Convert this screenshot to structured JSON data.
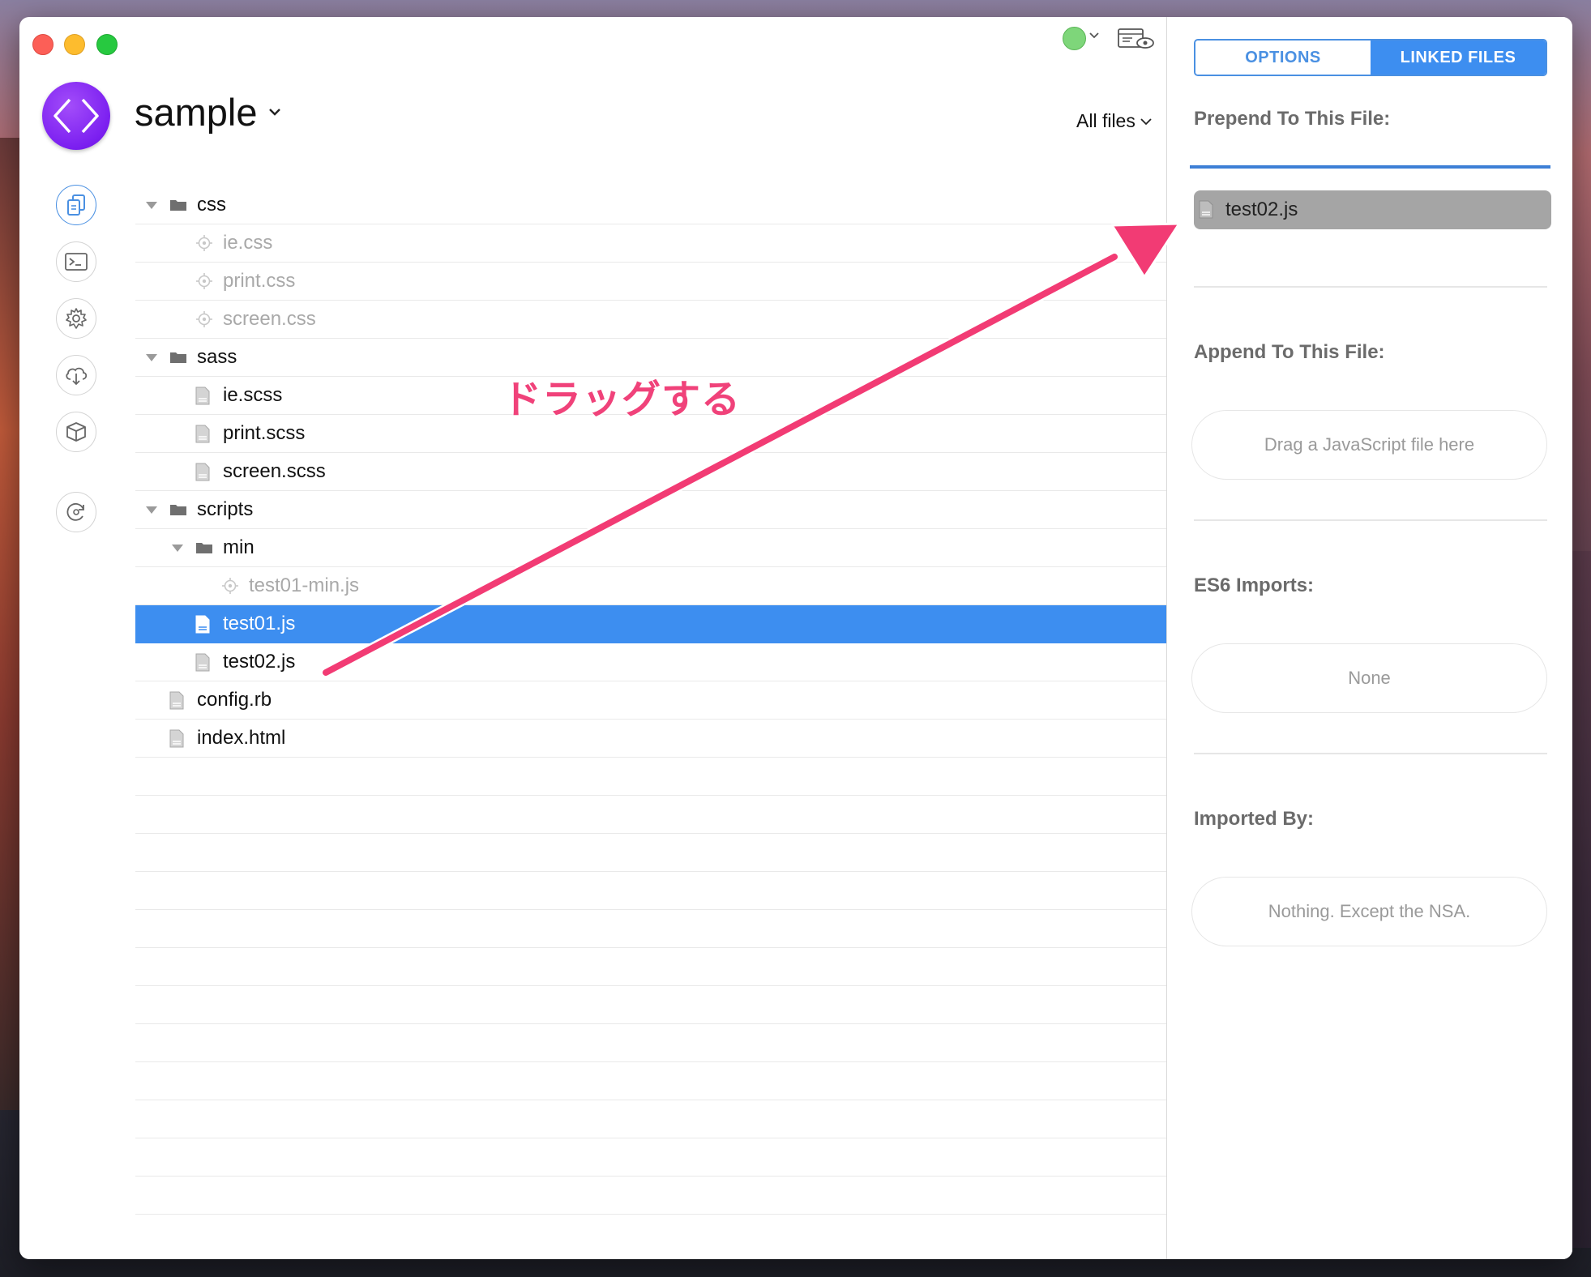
{
  "project": {
    "name": "sample",
    "filter": "All files"
  },
  "files": [
    {
      "name": "css",
      "kind": "folder",
      "depth": 0,
      "expanded": true,
      "dim": false,
      "selected": false
    },
    {
      "name": "ie.css",
      "kind": "output",
      "depth": 1,
      "dim": true,
      "selected": false
    },
    {
      "name": "print.css",
      "kind": "output",
      "depth": 1,
      "dim": true,
      "selected": false
    },
    {
      "name": "screen.css",
      "kind": "output",
      "depth": 1,
      "dim": true,
      "selected": false
    },
    {
      "name": "sass",
      "kind": "folder",
      "depth": 0,
      "expanded": true,
      "dim": false,
      "selected": false
    },
    {
      "name": "ie.scss",
      "kind": "file",
      "depth": 1,
      "dim": false,
      "selected": false
    },
    {
      "name": "print.scss",
      "kind": "file",
      "depth": 1,
      "dim": false,
      "selected": false
    },
    {
      "name": "screen.scss",
      "kind": "file",
      "depth": 1,
      "dim": false,
      "selected": false
    },
    {
      "name": "scripts",
      "kind": "folder",
      "depth": 0,
      "expanded": true,
      "dim": false,
      "selected": false
    },
    {
      "name": "min",
      "kind": "folder",
      "depth": 1,
      "expanded": true,
      "dim": false,
      "selected": false
    },
    {
      "name": "test01-min.js",
      "kind": "output",
      "depth": 2,
      "dim": true,
      "selected": false
    },
    {
      "name": "test01.js",
      "kind": "file",
      "depth": 1,
      "dim": false,
      "selected": true
    },
    {
      "name": "test02.js",
      "kind": "file",
      "depth": 1,
      "dim": false,
      "selected": false
    },
    {
      "name": "config.rb",
      "kind": "file",
      "depth": 0,
      "dim": false,
      "selected": false
    },
    {
      "name": "index.html",
      "kind": "file",
      "depth": 0,
      "dim": false,
      "selected": false
    }
  ],
  "empty_rows": 12,
  "panel": {
    "tabs": {
      "options": "OPTIONS",
      "linked": "LINKED FILES",
      "active": "linked"
    },
    "prepend": {
      "title": "Prepend To This File:",
      "item": "test02.js"
    },
    "append": {
      "title": "Append To This File:",
      "placeholder": "Drag a JavaScript file here"
    },
    "es6": {
      "title": "ES6 Imports:",
      "value": "None"
    },
    "imported_by": {
      "title": "Imported By:",
      "value": "Nothing. Except the NSA."
    }
  },
  "annotation": {
    "text": "ドラッグする",
    "color": "#f0427a"
  },
  "colors": {
    "accent": "#3d8ef0",
    "project_icon": "#7b1ff0",
    "status": "#7ed67a"
  }
}
